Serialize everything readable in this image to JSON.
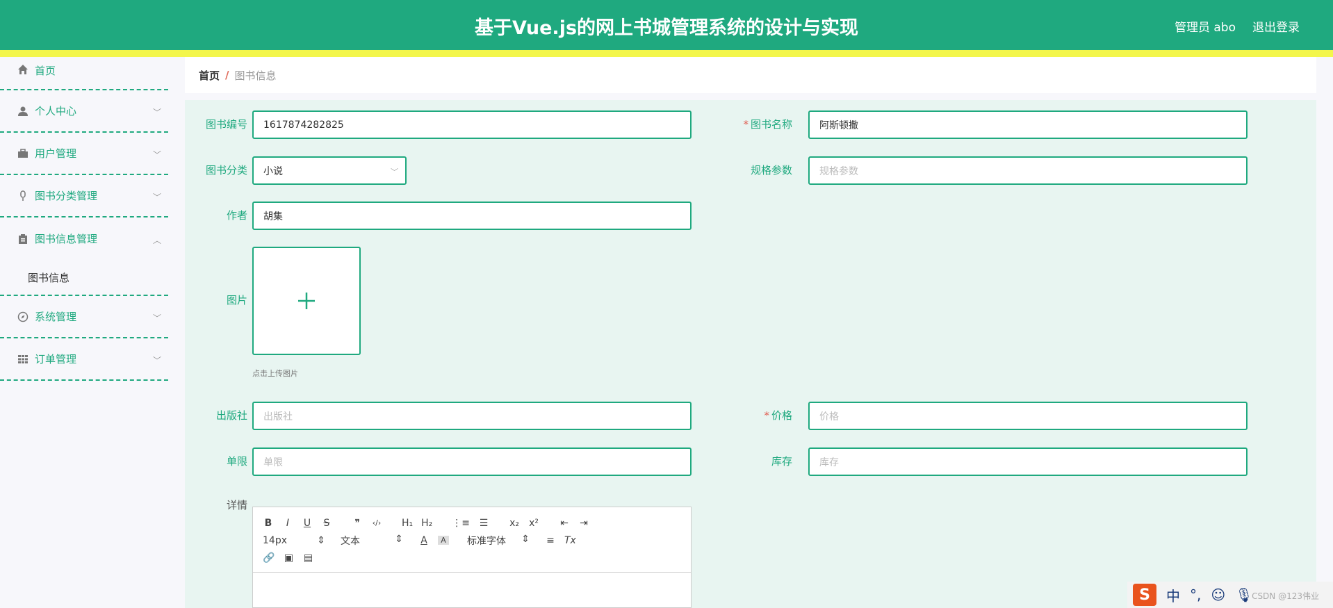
{
  "header": {
    "title": "基于Vue.js的网上书城管理系统的设计与实现",
    "user": "管理员 abo",
    "logout": "退出登录"
  },
  "sidebar": {
    "items": [
      {
        "label": "首页",
        "icon": "home-icon"
      },
      {
        "label": "个人中心",
        "icon": "user-icon"
      },
      {
        "label": "用户管理",
        "icon": "briefcase-icon"
      },
      {
        "label": "图书分类管理",
        "icon": "microphone-icon"
      },
      {
        "label": "图书信息管理",
        "icon": "clipboard-icon",
        "expanded": true,
        "submenu": [
          "图书信息"
        ]
      },
      {
        "label": "系统管理",
        "icon": "compass-icon"
      },
      {
        "label": "订单管理",
        "icon": "grid-icon"
      }
    ]
  },
  "breadcrumb": {
    "home": "首页",
    "separator": "/",
    "current": "图书信息"
  },
  "form": {
    "book_no": {
      "label": "图书编号",
      "value": "1617874282825"
    },
    "book_name": {
      "label": "图书名称",
      "value": "阿斯顿撒",
      "required": true
    },
    "category": {
      "label": "图书分类",
      "value": "小说"
    },
    "spec": {
      "label": "规格参数",
      "placeholder": "规格参数"
    },
    "author": {
      "label": "作者",
      "value": "胡集"
    },
    "image": {
      "label": "图片",
      "tip": "点击上传图片"
    },
    "publisher": {
      "label": "出版社",
      "placeholder": "出版社"
    },
    "price": {
      "label": "价格",
      "placeholder": "价格",
      "required": true
    },
    "limit": {
      "label": "单限",
      "placeholder": "单限"
    },
    "stock": {
      "label": "库存",
      "placeholder": "库存"
    },
    "detail": {
      "label": "详情"
    }
  },
  "editor": {
    "row1": [
      "B",
      "I",
      "U",
      "S",
      "❞",
      "‹/›",
      "H₁",
      "H₂",
      "⋮≡",
      "☰",
      "x₂",
      "x²",
      "⇤",
      "⇥"
    ],
    "size": "14px",
    "format": "文本",
    "font": "标准字体",
    "row3": [
      "🔗",
      "▣",
      "▤"
    ]
  },
  "ime": {
    "lang": "中",
    "punct": "°,",
    "watermark": "CSDN @123伟业"
  },
  "colors": {
    "primary": "#1fa97f",
    "strip": "#f3f64b",
    "required": "#e05a4e"
  }
}
